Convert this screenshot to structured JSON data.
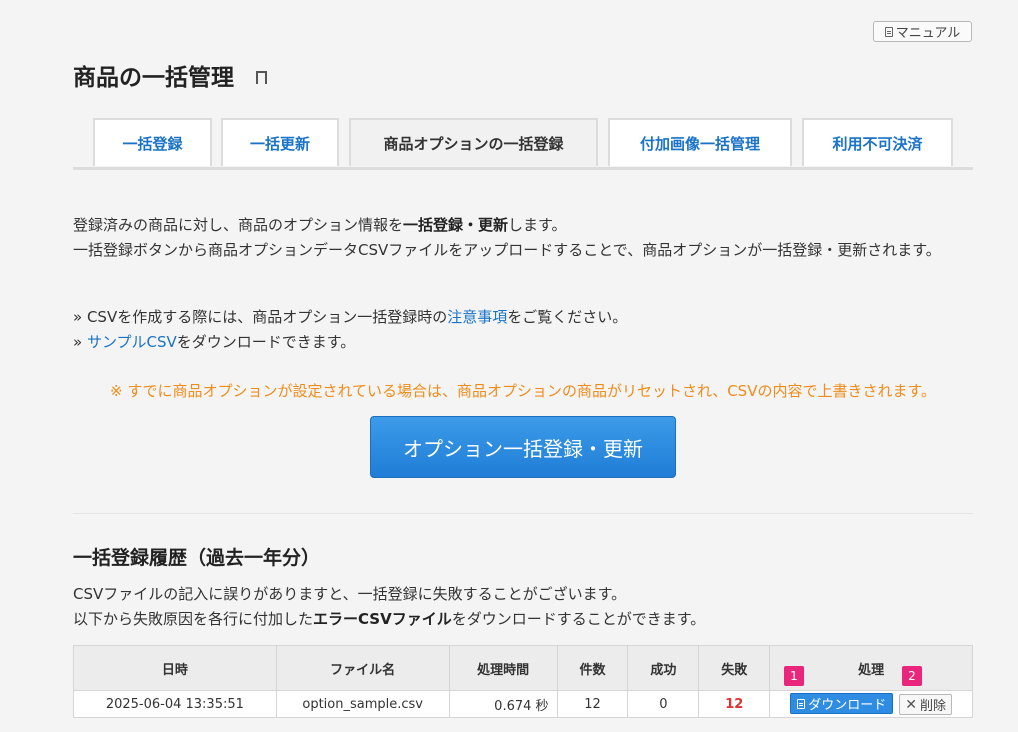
{
  "header": {
    "manual_label": "マニュアル",
    "title": "商品の一括管理"
  },
  "tabs": [
    {
      "label": "一括登録"
    },
    {
      "label": "一括更新"
    },
    {
      "label": "商品オプションの一括登録"
    },
    {
      "label": "付加画像一括管理"
    },
    {
      "label": "利用不可決済"
    }
  ],
  "intro": {
    "line1_pre": "登録済みの商品に対し、商品のオプション情報を",
    "line1_bold": "一括登録・更新",
    "line1_post": "します。",
    "line2": "一括登録ボタンから商品オプションデータCSVファイルをアップロードすることで、商品オプションが一括登録・更新されます。"
  },
  "notes": {
    "note1_pre": "» CSVを作成する際には、商品オプション一括登録時の",
    "note1_link": "注意事項",
    "note1_post": "をご覧ください。",
    "note2_pre": "» ",
    "note2_link": "サンプルCSV",
    "note2_post": "をダウンロードできます。"
  },
  "warning": "※ すでに商品オプションが設定されている場合は、商品オプションの商品がリセットされ、CSVの内容で上書きされます。",
  "main_button": "オプション一括登録・更新",
  "history": {
    "title": "一括登録履歴（過去一年分）",
    "desc1": "CSVファイルの記入に誤りがありますと、一括登録に失敗することがございます。",
    "desc2_pre": "以下から失敗原因を各行に付加した",
    "desc2_bold": "エラーCSVファイル",
    "desc2_post": "をダウンロードすることができます。",
    "columns": [
      "日時",
      "ファイル名",
      "処理時間",
      "件数",
      "成功",
      "失敗",
      "処理"
    ],
    "rows": [
      {
        "datetime": "2025-06-04 13:35:51",
        "filename": "option_sample.csv",
        "time": "0.674 秒",
        "count": "12",
        "success": "0",
        "fail": "12",
        "download_label": "ダウンロード",
        "delete_label": "削除"
      }
    ]
  },
  "markers": [
    "1",
    "2"
  ],
  "colors": {
    "link": "#1a73c9",
    "warning": "#f08c1a",
    "primary_button": "#1f7dd6",
    "fail": "#e03131",
    "marker": "#e9267c"
  }
}
